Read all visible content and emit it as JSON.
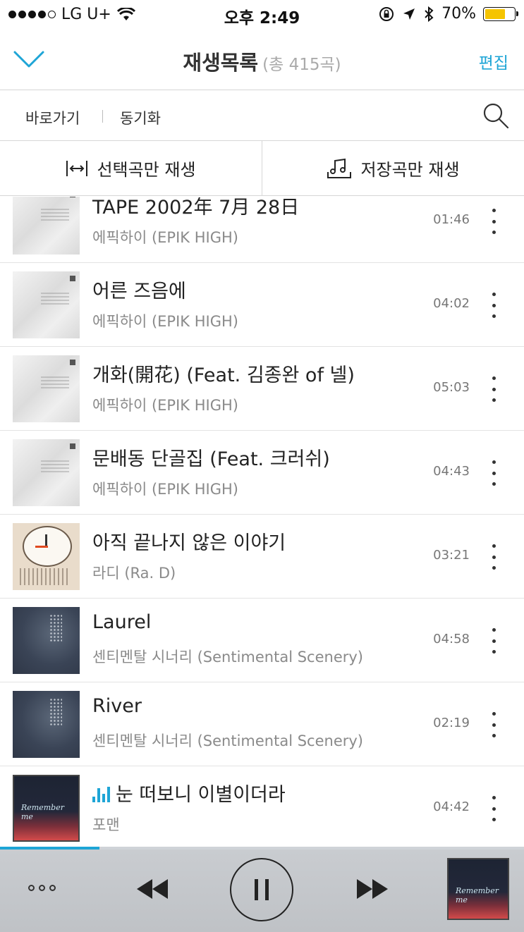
{
  "status": {
    "carrier": "LG U+",
    "time": "오후 2:49",
    "battery": "70%"
  },
  "header": {
    "title": "재생목록",
    "count": "(총 415곡)",
    "edit_label": "편집"
  },
  "subnav": {
    "shortcut_label": "바로가기",
    "sync_label": "동기화"
  },
  "play_modes": {
    "selected_only": "선택곡만 재생",
    "saved_only": "저장곡만 재생"
  },
  "tracks": [
    {
      "title": "TAPE 2002年 7月 28日",
      "artist": "에픽하이 (EPIK HIGH)",
      "duration": "01:46",
      "art": "white"
    },
    {
      "title": "어른 즈음에",
      "artist": "에픽하이 (EPIK HIGH)",
      "duration": "04:02",
      "art": "white"
    },
    {
      "title": "개화(開花) (Feat. 김종완 of 넬)",
      "artist": "에픽하이 (EPIK HIGH)",
      "duration": "05:03",
      "art": "white"
    },
    {
      "title": "문배동 단골집 (Feat. 크러쉬)",
      "artist": "에픽하이 (EPIK HIGH)",
      "duration": "04:43",
      "art": "white"
    },
    {
      "title": "아직 끝나지 않은 이야기",
      "artist": "라디 (Ra. D)",
      "duration": "03:21",
      "art": "clock"
    },
    {
      "title": "Laurel",
      "artist": "센티멘탈 시너리 (Sentimental Scenery)",
      "duration": "04:58",
      "art": "night"
    },
    {
      "title": "River",
      "artist": "센티멘탈 시너리 (Sentimental Scenery)",
      "duration": "02:19",
      "art": "night"
    },
    {
      "title": "눈 떠보니 이별이더라",
      "artist": "포맨",
      "duration": "04:42",
      "art": "remember",
      "playing": true
    }
  ],
  "player": {
    "progress": 0.19,
    "state": "playing"
  },
  "icons": {
    "collapse": "chevron-down-icon",
    "search": "search-icon",
    "selected_play": "arrows-horizontal-icon",
    "saved_play": "music-note-icon",
    "more": "more-vertical-icon",
    "now_playing": "equalizer-icon",
    "menu": "more-horizontal-icon",
    "prev": "rewind-icon",
    "pause": "pause-icon",
    "next": "fast-forward-icon"
  },
  "colors": {
    "accent": "#1ea5d6"
  }
}
